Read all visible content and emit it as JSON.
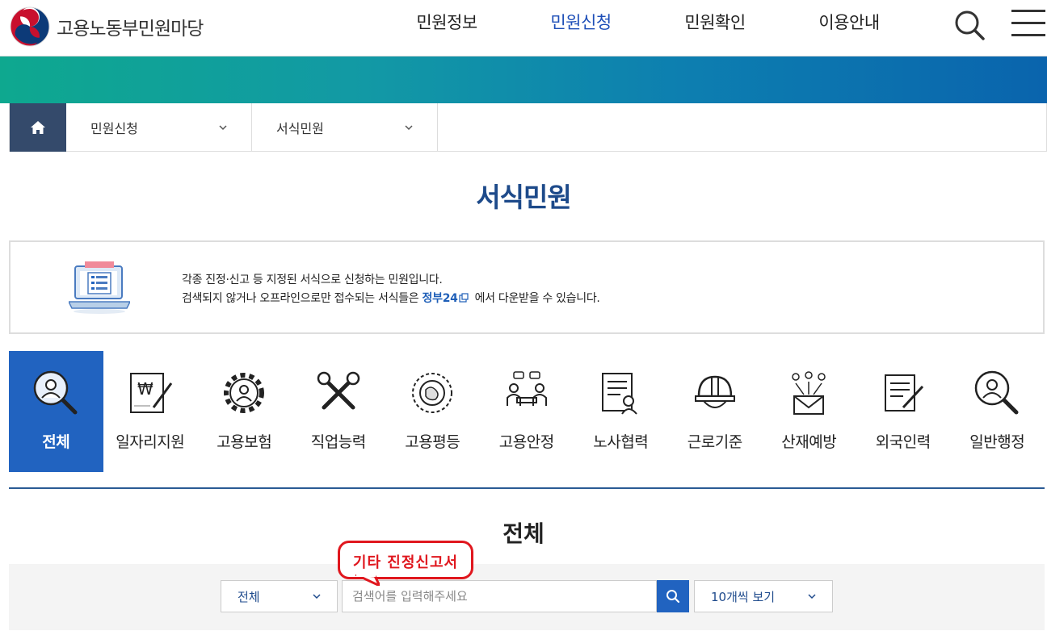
{
  "header": {
    "logo_text": "고용노동부민원마당",
    "nav": [
      {
        "label": "민원정보",
        "active": false
      },
      {
        "label": "민원신청",
        "active": true
      },
      {
        "label": "민원확인",
        "active": false
      },
      {
        "label": "이용안내",
        "active": false
      }
    ],
    "active_color": "#1e4fb8"
  },
  "breadcrumb": {
    "level1": "민원신청",
    "level2": "서식민원"
  },
  "page_title": "서식민원",
  "info": {
    "line1": "각종 진정·신고 등 지정된 서식으로 신청하는 민원입니다.",
    "line2_before": "검색되지 않거나 오프라인으로만 접수되는 서식들은",
    "line2_link": "정부24",
    "line2_after": "에서 다운받을 수 있습니다."
  },
  "categories": [
    {
      "label": "전체",
      "icon": "person-search-icon",
      "active": true
    },
    {
      "label": "일자리지원",
      "icon": "document-pen-icon",
      "active": false
    },
    {
      "label": "고용보험",
      "icon": "gear-person-icon",
      "active": false
    },
    {
      "label": "직업능력",
      "icon": "tools-icon",
      "active": false
    },
    {
      "label": "고용평등",
      "icon": "globe-people-icon",
      "active": false
    },
    {
      "label": "고용안정",
      "icon": "meeting-icon",
      "active": false
    },
    {
      "label": "노사협력",
      "icon": "contract-icon",
      "active": false
    },
    {
      "label": "근로기준",
      "icon": "helmet-icon",
      "active": false
    },
    {
      "label": "산재예방",
      "icon": "mail-people-icon",
      "active": false
    },
    {
      "label": "외국인력",
      "icon": "form-pen-icon",
      "active": false
    },
    {
      "label": "일반행정",
      "icon": "magnifier-person-icon",
      "active": false
    }
  ],
  "section_title": "전체",
  "search": {
    "category_selected": "전체",
    "placeholder": "검색어를 입력해주세요",
    "page_size_selected": "10개씩 보기"
  },
  "annotation": {
    "text": "기타 진정신고서",
    "color": "#e0171e"
  }
}
